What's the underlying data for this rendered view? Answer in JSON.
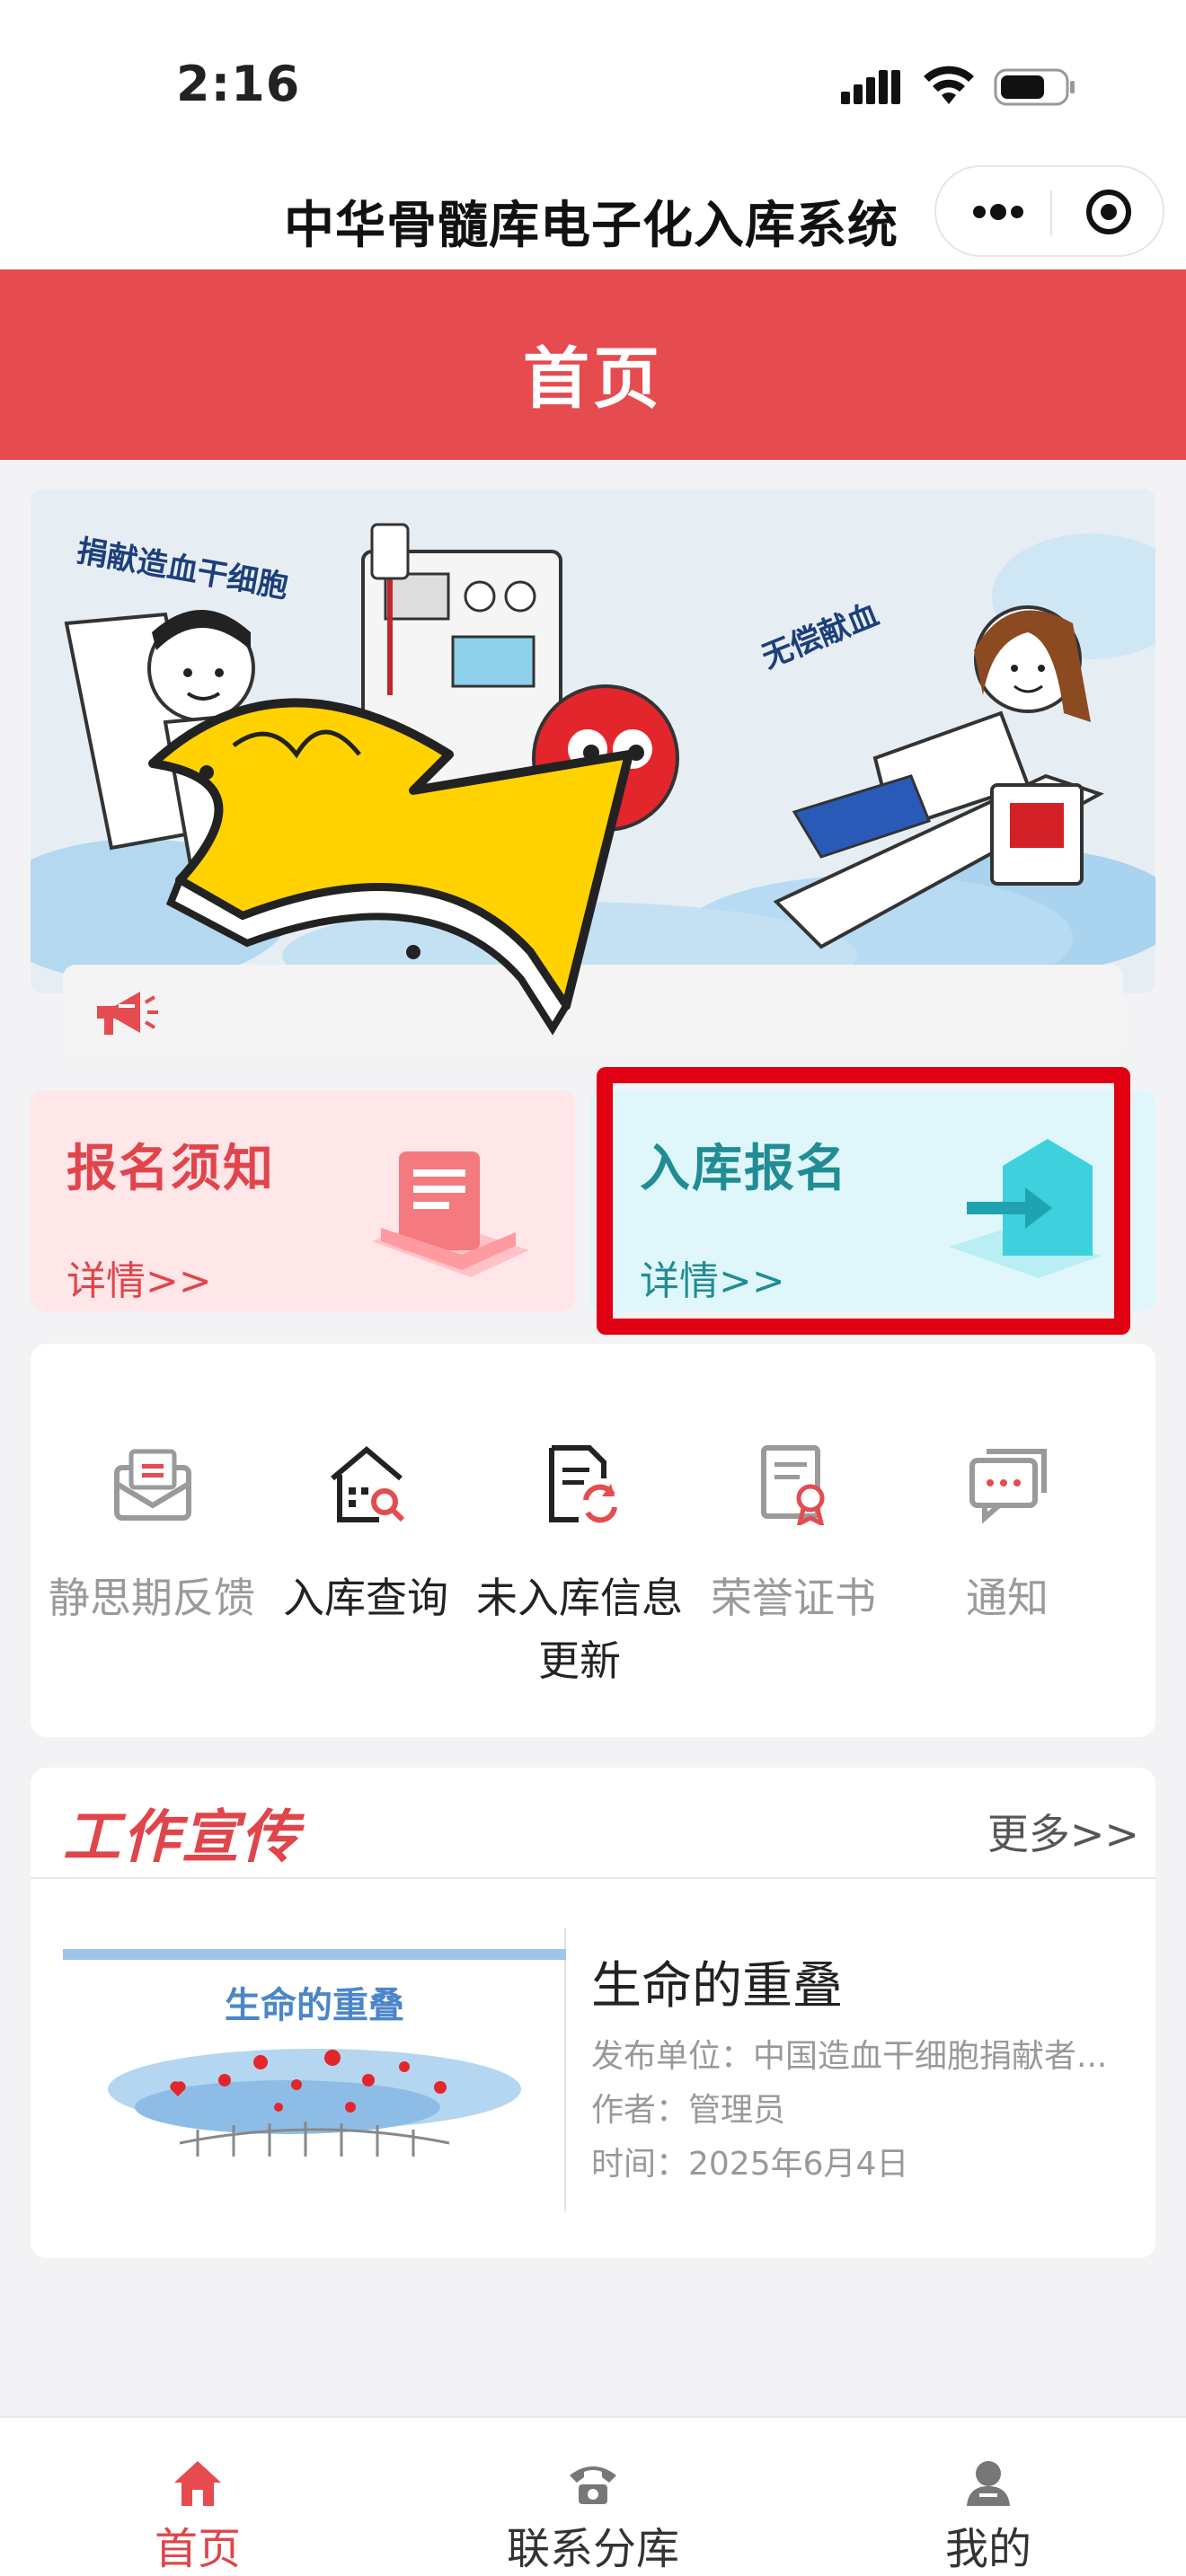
{
  "status_bar": {
    "time": "2:16"
  },
  "nav": {
    "title": "中华骨髓库电子化入库系统"
  },
  "header": {
    "title": "首页"
  },
  "banner": {
    "text_left": "捐献造血干细胞",
    "text_right": "无偿献血"
  },
  "cards": {
    "notice": {
      "title": "报名须知",
      "link": "详情>>"
    },
    "register": {
      "title": "入库报名",
      "link": "详情>>"
    }
  },
  "functions": [
    {
      "label": "静思期反馈",
      "icon": "envelope-icon"
    },
    {
      "label": "入库查询",
      "icon": "building-search-icon"
    },
    {
      "label": "未入库信息更新",
      "icon": "document-refresh-icon"
    },
    {
      "label": "荣誉证书",
      "icon": "certificate-icon"
    },
    {
      "label": "通知",
      "icon": "message-icon"
    }
  ],
  "promo": {
    "title": "工作宣传",
    "more": "更多>>",
    "article": {
      "thumb_title": "生命的重叠",
      "title": "生命的重叠",
      "publisher": "发布单位：中国造血干细胞捐献者...",
      "author": "作者：管理员",
      "time": "时间：2025年6月4日"
    }
  },
  "tabbar": [
    {
      "label": "首页",
      "icon": "home-icon",
      "active": true
    },
    {
      "label": "联系分库",
      "icon": "phone-icon",
      "active": false
    },
    {
      "label": "我的",
      "icon": "user-icon",
      "active": false
    }
  ],
  "colors": {
    "brand_red": "#e54b4f",
    "highlight_red": "#e00012",
    "teal": "#218c93",
    "notice_bg": "#ffe6e8",
    "register_bg": "#dff7fb"
  }
}
